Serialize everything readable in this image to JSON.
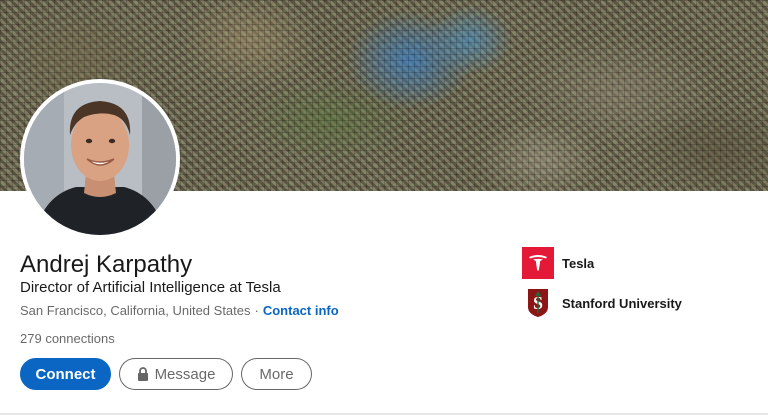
{
  "profile": {
    "name": "Andrej Karpathy",
    "headline": "Director of Artificial Intelligence at Tesla",
    "location": "San Francisco, California, United States",
    "separator": "·",
    "contact_info_label": "Contact info",
    "connections_count": "279",
    "connections_label": "connections"
  },
  "actions": {
    "connect_label": "Connect",
    "message_label": "Message",
    "more_label": "More"
  },
  "organizations": [
    {
      "name": "Tesla",
      "logo_icon": "tesla-logo-icon",
      "logo_color": "#e31937"
    },
    {
      "name": "Stanford University",
      "logo_icon": "stanford-logo-icon",
      "logo_color": "#8c1515"
    }
  ],
  "colors": {
    "accent": "#0a66c2",
    "text_primary": "rgba(0,0,0,0.9)",
    "text_secondary": "rgba(0,0,0,0.6)"
  }
}
